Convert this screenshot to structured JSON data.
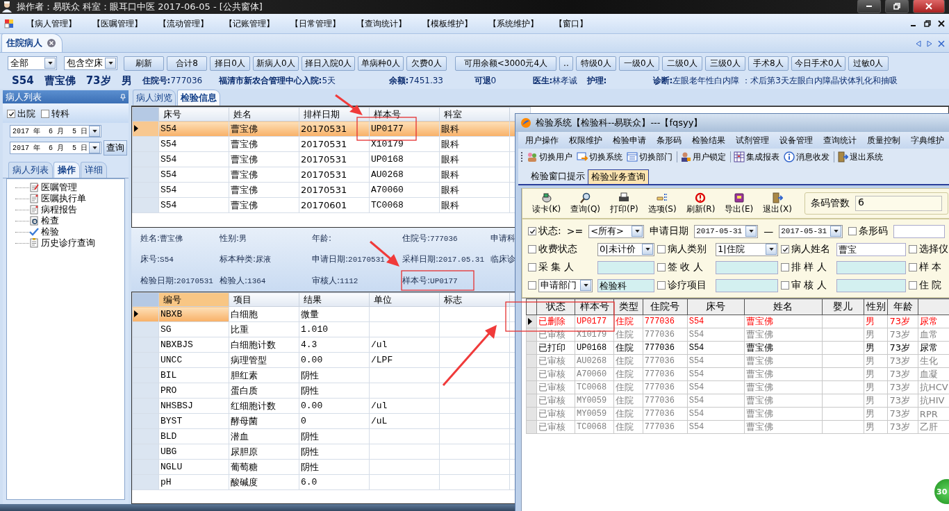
{
  "title_bar": {
    "title": "操作者：易联众  科室：眼耳口中医  2017-06-05 - [公共窗体]"
  },
  "menu": [
    "【病人管理】",
    "【医嘱管理】",
    "【流动管理】",
    "【记账管理】",
    "【日常管理】",
    "【查询统计】",
    "【模板维护】",
    "【系统维护】",
    "【窗口】"
  ],
  "doc_tab": {
    "label": "住院病人",
    "selected": true
  },
  "filters": {
    "ward": "全部",
    "bed": "包含空床"
  },
  "buttons": [
    "刷新",
    "合计8",
    "择日0人",
    "新病人0人",
    "择日入院0人",
    "单病种0人",
    "欠费0人",
    "可用余额<3000元4人",
    "..",
    "特级0人",
    "一级0人",
    "二级0人",
    "三级0人",
    "手术8人",
    "今日手术0人",
    "过敏0人"
  ],
  "patient": {
    "bed": "S54",
    "name": "曹宝佛",
    "age": "73岁",
    "sex": "男",
    "fields": [
      {
        "label": "住院号:",
        "value": "777036"
      },
      {
        "label": "福清市新农合管理中心入院:",
        "value": "5天"
      },
      {
        "label": "余额:",
        "value": "7451.33"
      },
      {
        "label": "可退",
        "value": "0"
      },
      {
        "label": "医生:",
        "value": "林孝诚"
      },
      {
        "label": "护理:"
      },
      {
        "label": "诊断:",
        "value": "左眼老年性白内障 ：术后第3天左眼白内障晶状体乳化和抽吸"
      }
    ]
  },
  "left_panel": {
    "title": "病人列表",
    "checks": [
      {
        "label": "出院",
        "checked": true
      },
      {
        "label": "转科",
        "checked": false
      }
    ],
    "dates": [
      "2017 年  6 月  5 日",
      "2017 年  6 月  5 日"
    ],
    "query_button": "查询",
    "tabs": [
      {
        "label": "病人列表",
        "selected": false
      },
      {
        "label": "操作",
        "selected": true
      },
      {
        "label": "详细",
        "selected": false
      }
    ],
    "tree": [
      {
        "label": "医嘱管理",
        "kind": "edit"
      },
      {
        "label": "医嘱执行单",
        "kind": "document"
      },
      {
        "label": "病程报告",
        "kind": "document"
      },
      {
        "label": "检查",
        "kind": "search"
      },
      {
        "label": "检验",
        "kind": "check"
      },
      {
        "label": "历史诊疗查询",
        "kind": "clipboard"
      }
    ]
  },
  "view_tabs": [
    {
      "label": "病人浏览",
      "selected": false
    },
    {
      "label": "检验信息",
      "selected": true
    }
  ],
  "sample_table": {
    "columns": [
      "床号",
      "姓名",
      "排样日期",
      "样本号",
      "科室"
    ],
    "rows": [
      {
        "selected": true,
        "cells": [
          "S54",
          "曹宝佛",
          "20170531",
          "UP0177",
          "眼科"
        ]
      },
      {
        "selected": false,
        "cells": [
          "S54",
          "曹宝佛",
          "20170531",
          "X10179",
          "眼科"
        ]
      },
      {
        "selected": false,
        "cells": [
          "S54",
          "曹宝佛",
          "20170531",
          "UP0168",
          "眼科"
        ]
      },
      {
        "selected": false,
        "cells": [
          "S54",
          "曹宝佛",
          "20170531",
          "AU0268",
          "眼科"
        ]
      },
      {
        "selected": false,
        "cells": [
          "S54",
          "曹宝佛",
          "20170531",
          "A70060",
          "眼科"
        ]
      },
      {
        "selected": false,
        "cells": [
          "S54",
          "曹宝佛",
          "20170601",
          "TC0068",
          "眼科"
        ]
      }
    ]
  },
  "detail": [
    [
      {
        "label": "姓名:",
        "value": "曹宝佛"
      },
      {
        "label": "性别:",
        "value": "男"
      },
      {
        "label": "年龄:"
      },
      {
        "label": "住院号:",
        "value": "777036"
      },
      {
        "label": "申请科"
      }
    ],
    [
      {
        "label": "床号:",
        "value": "S54"
      },
      {
        "label": "标本种类:",
        "value": "尿液"
      },
      {
        "label": "申请日期:",
        "value": "20170531"
      },
      {
        "label": "采样日期:",
        "value": "2017.05.31"
      },
      {
        "label": "临床诊"
      }
    ],
    [
      {
        "label": "检验日期:",
        "value": "20170531"
      },
      {
        "label": "检验人:",
        "value": "1364"
      },
      {
        "label": "审核人:",
        "value": "1112"
      },
      {
        "label": "样本号:",
        "value": "UP0177"
      }
    ]
  ],
  "result_table": {
    "columns": [
      "编号",
      "项目",
      "结果",
      "单位",
      "标志"
    ],
    "rows": [
      {
        "selected": true,
        "code": "NBXB",
        "item": "白细胞",
        "result": "微量"
      },
      {
        "selected": false,
        "code": "SG",
        "item": "比重",
        "result": "1.010"
      },
      {
        "selected": false,
        "code": "NBXBJS",
        "item": "白细胞计数",
        "result": "4.3",
        "unit": "/ul"
      },
      {
        "selected": false,
        "code": "UNCC",
        "item": "病理管型",
        "result": "0.00",
        "unit": "/LPF"
      },
      {
        "selected": false,
        "code": "BIL",
        "item": "胆红素",
        "result": "阴性"
      },
      {
        "selected": false,
        "code": "PRO",
        "item": "蛋白质",
        "result": "阴性"
      },
      {
        "selected": false,
        "code": "NHSBSJ",
        "item": "红细胞计数",
        "result": "0.00",
        "unit": "/ul"
      },
      {
        "selected": false,
        "code": "BYST",
        "item": "酵母菌",
        "result": "0",
        "unit": "/uL"
      },
      {
        "selected": false,
        "code": "BLD",
        "item": "潜血",
        "result": "阴性"
      },
      {
        "selected": false,
        "code": "UBG",
        "item": "尿胆原",
        "result": "阴性"
      },
      {
        "selected": false,
        "code": "NGLU",
        "item": "葡萄糖",
        "result": "阴性"
      },
      {
        "selected": false,
        "code": "pH",
        "item": "酸碱度",
        "result": "6.0"
      }
    ]
  },
  "lab_window": {
    "title": "检验系统【检验科--易联众】---【fqsyy】",
    "menu": [
      "用户操作",
      "权限维护",
      "检验申请",
      "条形码",
      "检验结果",
      "试剂管理",
      "设备管理",
      "查询统计",
      "质量控制",
      "字典维护"
    ],
    "toolbar": [
      {
        "label": "切换用户",
        "kind": "users"
      },
      {
        "label": "切换系统",
        "kind": "switch"
      },
      {
        "label": "切换部门",
        "kind": "calendar"
      },
      {
        "label": "用户锁定",
        "kind": "lock"
      },
      {
        "label": "集成报表",
        "kind": "report"
      },
      {
        "label": "消息收发",
        "kind": "info"
      },
      {
        "label": "退出系统",
        "kind": "exit"
      }
    ],
    "tabs": [
      {
        "label": "检验窗口提示",
        "selected": false
      },
      {
        "label": "检验业务查询",
        "selected": true
      }
    ],
    "actions": [
      {
        "label": "读卡(K)",
        "kind": "card"
      },
      {
        "label": "查询(Q)",
        "kind": "search"
      },
      {
        "label": "打印(P)",
        "kind": "print"
      },
      {
        "label": "选项(S)",
        "kind": "options"
      },
      {
        "label": "刷新(R)",
        "kind": "refresh"
      },
      {
        "label": "导出(E)",
        "kind": "export"
      },
      {
        "label": "退出(X)",
        "kind": "exit"
      }
    ],
    "barcode_count": {
      "label": "条码管数",
      "value": "6"
    },
    "filter_top": {
      "status_label": "状态:",
      "status_checked": true,
      "op": ">=",
      "status_value": "<所有>",
      "date_label": "申请日期",
      "date_from": "2017-05-31",
      "date_sep": "—",
      "date_to": "2017-05-31",
      "barcode_label": "条形码",
      "barcode_checked": false
    },
    "filter_rows": [
      [
        {
          "kind": "check",
          "label": "收费状态",
          "checked": false
        },
        {
          "kind": "select",
          "value": "0|未计价"
        },
        {
          "kind": "check",
          "label": "病人类别",
          "checked": false
        },
        {
          "kind": "select",
          "value": "1|住院"
        },
        {
          "kind": "check",
          "label": "病人姓名",
          "checked": true
        },
        {
          "kind": "field",
          "value": "曹宝"
        },
        {
          "kind": "check",
          "label": "选择仪",
          "checked": false
        }
      ],
      [
        {
          "kind": "check",
          "label": "采 集 人",
          "checked": false
        },
        {
          "kind": "field"
        },
        {
          "kind": "check",
          "label": "签 收 人",
          "checked": false
        },
        {
          "kind": "field"
        },
        {
          "kind": "check",
          "label": "排 样 人",
          "checked": false
        },
        {
          "kind": "field"
        },
        {
          "kind": "check",
          "label": "样 本",
          "checked": false
        }
      ],
      [
        {
          "kind": "check_select",
          "value": "申请部门",
          "checked": false
        },
        {
          "kind": "field",
          "value": "检验科"
        },
        {
          "kind": "check",
          "label": "诊疗项目",
          "checked": false
        },
        {
          "kind": "field"
        },
        {
          "kind": "check",
          "label": "审 核 人",
          "checked": false
        },
        {
          "kind": "field"
        },
        {
          "kind": "check",
          "label": "住 院",
          "checked": false
        }
      ]
    ],
    "table": {
      "columns": [
        "状态",
        "样本号",
        "类型",
        "住院号",
        "床号",
        "姓名",
        "婴儿",
        "性别",
        "年龄"
      ],
      "rows": [
        {
          "kind": "deleted",
          "selected": true,
          "cells": [
            "已删除",
            "UP0177",
            "住院",
            "777036",
            "S54",
            "曹宝佛",
            "",
            "男",
            "73岁",
            "尿常"
          ]
        },
        {
          "kind": "reviewed",
          "selected": false,
          "cells": [
            "已审核",
            "X10179",
            "住院",
            "777036",
            "S54",
            "曹宝佛",
            "",
            "男",
            "73岁",
            "血常"
          ]
        },
        {
          "kind": "printed",
          "selected": false,
          "cells": [
            "已打印",
            "UP0168",
            "住院",
            "777036",
            "S54",
            "曹宝佛",
            "",
            "男",
            "73岁",
            "尿常"
          ]
        },
        {
          "kind": "reviewed",
          "selected": false,
          "cells": [
            "已审核",
            "AU0268",
            "住院",
            "777036",
            "S54",
            "曹宝佛",
            "",
            "男",
            "73岁",
            "生化"
          ]
        },
        {
          "kind": "reviewed",
          "selected": false,
          "cells": [
            "已审核",
            "A70060",
            "住院",
            "777036",
            "S54",
            "曹宝佛",
            "",
            "男",
            "73岁",
            "血凝"
          ]
        },
        {
          "kind": "reviewed",
          "selected": false,
          "cells": [
            "已审核",
            "TC0068",
            "住院",
            "777036",
            "S54",
            "曹宝佛",
            "",
            "男",
            "73岁",
            "抗HCV"
          ]
        },
        {
          "kind": "reviewed",
          "selected": false,
          "cells": [
            "已审核",
            "MY0059",
            "住院",
            "777036",
            "S54",
            "曹宝佛",
            "",
            "男",
            "73岁",
            "抗HIV"
          ]
        },
        {
          "kind": "reviewed",
          "selected": false,
          "cells": [
            "已审核",
            "MY0059",
            "住院",
            "777036",
            "S54",
            "曹宝佛",
            "",
            "男",
            "73岁",
            "RPR"
          ]
        },
        {
          "kind": "reviewed",
          "selected": false,
          "cells": [
            "已审核",
            "TC0068",
            "住院",
            "777036",
            "S54",
            "曹宝佛",
            "",
            "男",
            "73岁",
            "乙肝"
          ]
        }
      ]
    }
  },
  "badge": {
    "text": "30"
  }
}
